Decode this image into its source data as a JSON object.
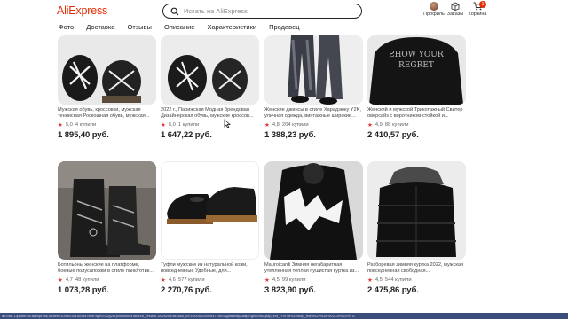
{
  "header": {
    "logo": "AliExpress",
    "search_placeholder": "Искать на AliExpress",
    "profile_label": "Профиль",
    "orders_label": "Заказы",
    "cart_label": "Корзина",
    "cart_count": "1"
  },
  "nav": {
    "tabs": [
      "Фото",
      "Доставка",
      "Отзывы",
      "Описание",
      "Характеристики",
      "Продавец"
    ]
  },
  "products": [
    {
      "title": "Мужская обувь, кроссовки, мужская теннисная Роскошная обувь, мужская...",
      "rating": "5,0",
      "sold": "4 купили",
      "price": "1 895,40 руб."
    },
    {
      "title": "2022 г., Парижская Модная брендовая Дизайнерская обувь, мужские кроссов...",
      "rating": "5,0",
      "sold": "1 купили",
      "price": "1 647,22 руб."
    },
    {
      "title": "Женские джинсы в стиле Харадзюку Y2K, уличная одежда, винтажные широкие...",
      "rating": "4,8",
      "sold": "204 купили",
      "price": "1 388,23 руб."
    },
    {
      "title": "Женский и мужской Трикотажный Свитер оверсайз с воротником-стойкой и...",
      "rating": "4,9",
      "sold": "88 купили",
      "price": "2 410,57 руб."
    },
    {
      "title": "Ботильоны женские на платформе, боевые полусапожки в стиле панк/готик...",
      "rating": "4,7",
      "sold": "48 купили",
      "price": "1 073,28 руб."
    },
    {
      "title": "Туфли мужские из натуральной кожи, повседневные Удобные, для...",
      "rating": "4,6",
      "sold": "577 купили",
      "price": "2 270,76 руб."
    },
    {
      "title": "Mauroicardi Зимняя негабаритная утепленная теплая пушистая куртка из...",
      "rating": "4,5",
      "sold": "99 купили",
      "price": "3 823,90 руб."
    },
    {
      "title": "Разборевая зимняя куртка 2022, мужская повседневная свободная...",
      "rating": "4,5",
      "sold": "544 купили",
      "price": "2 475,86 руб."
    }
  ],
  "status_bar": "ali-mal-1.lpnhnt.ml.aliexpress.ru/item/1005004316939.html?spm=a2g2w.productlist.search_results.18.2f25fe3d&sku_id=12000028904471963&gatewayAdapt=glo2rus&pdp_ext_f=%7B%22ship_from%22%3A%22CN%22%7D"
}
